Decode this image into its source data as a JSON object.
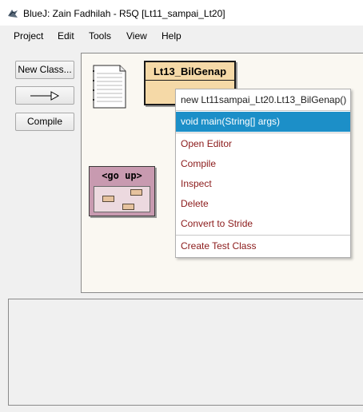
{
  "window": {
    "title": "BlueJ:  Zain Fadhilah - R5Q  [Lt11_sampai_Lt20]"
  },
  "menubar": {
    "items": [
      "Project",
      "Edit",
      "Tools",
      "View",
      "Help"
    ]
  },
  "toolbar": {
    "new_class": "New Class...",
    "compile": "Compile"
  },
  "diagram": {
    "class_name": "Lt13_BilGenap",
    "package_label": "<go up>"
  },
  "context_menu": {
    "constructor": "new Lt11sampai_Lt20.Lt13_BilGenap()",
    "main_method": "void main(String[] args)",
    "open_editor": "Open Editor",
    "compile": "Compile",
    "inspect": "Inspect",
    "delete": "Delete",
    "convert_to_stride": "Convert to Stride",
    "create_test_class": "Create Test Class"
  },
  "colors": {
    "selected_item": "#1c8fc8",
    "class_fill": "#f5d9a7",
    "package_fill": "#c89ab0",
    "menu_action_text": "#8b1a1a"
  }
}
